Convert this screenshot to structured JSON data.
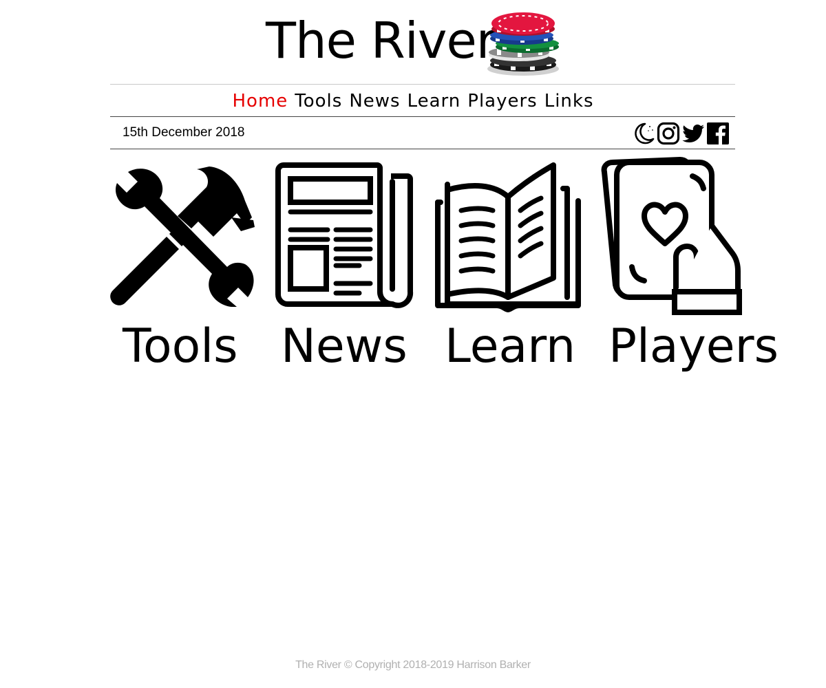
{
  "header": {
    "title": "The River",
    "logo_icon": "poker-chips-icon"
  },
  "nav": {
    "items": [
      {
        "label": "Home",
        "active": true
      },
      {
        "label": "Tools",
        "active": false
      },
      {
        "label": "News",
        "active": false
      },
      {
        "label": "Learn",
        "active": false
      },
      {
        "label": "Players",
        "active": false
      },
      {
        "label": "Links",
        "active": false
      }
    ],
    "active_color": "#e60000"
  },
  "date_bar": {
    "date": "15th December 2018",
    "icons": [
      "dark-mode-moon-icon",
      "instagram-icon",
      "twitter-icon",
      "facebook-icon"
    ]
  },
  "tiles": [
    {
      "label": "Tools",
      "icon": "wrench-hammer-icon"
    },
    {
      "label": "News",
      "icon": "newspaper-icon"
    },
    {
      "label": "Learn",
      "icon": "open-book-icon"
    },
    {
      "label": "Players",
      "icon": "hand-holding-cards-icon"
    }
  ],
  "footer": {
    "text": "The River © Copyright 2018-2019 Harrison Barker",
    "color": "#b0b0b0"
  }
}
